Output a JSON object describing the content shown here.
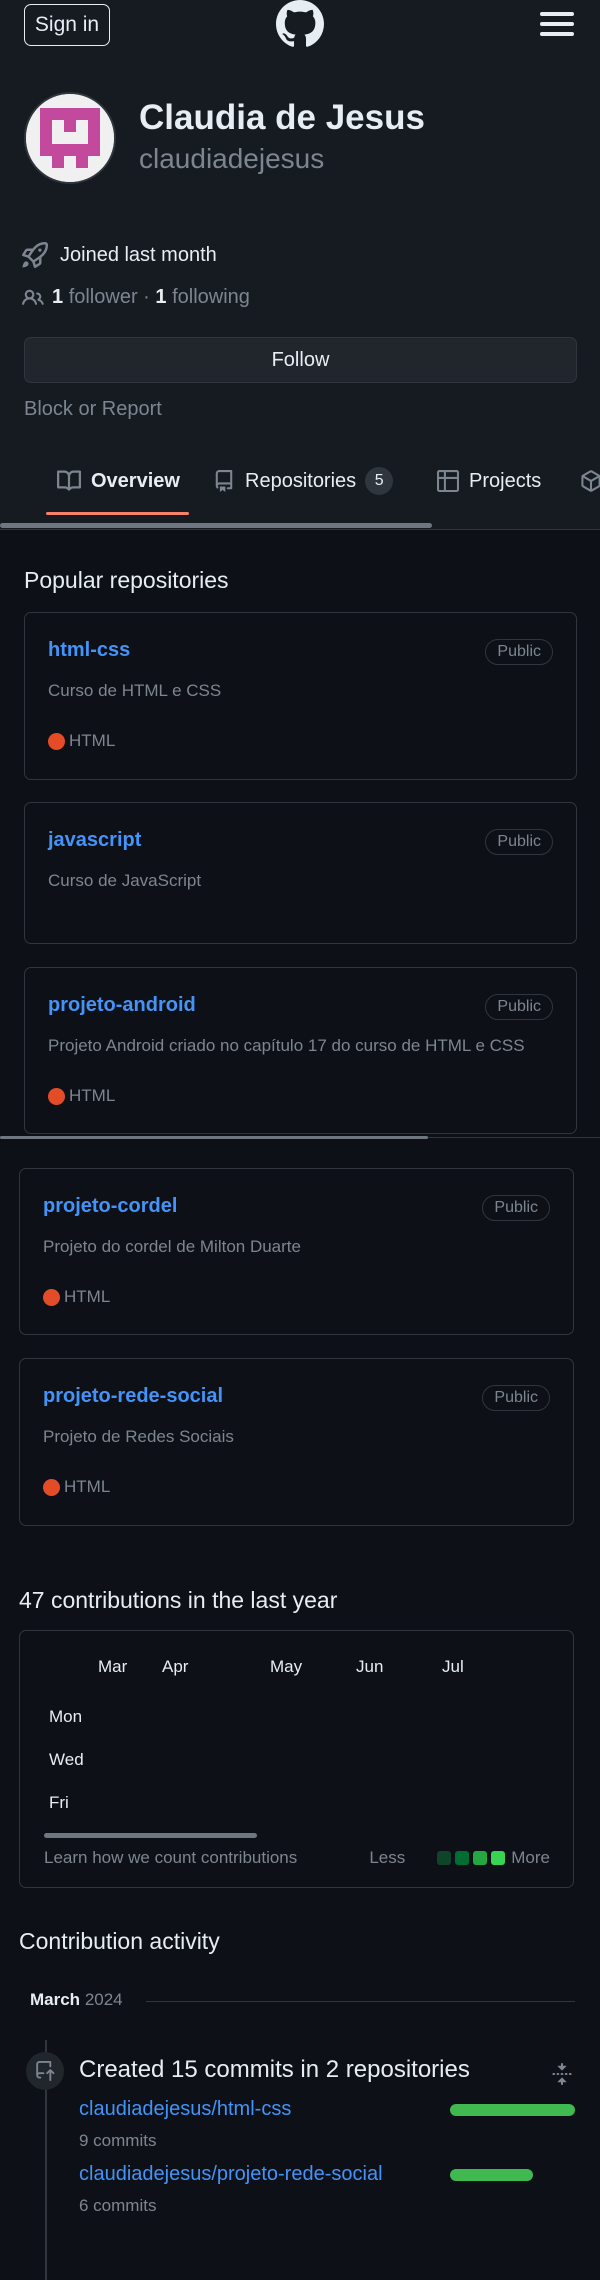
{
  "header": {
    "signin_label": "Sign in"
  },
  "profile": {
    "full_name": "Claudia de Jesus",
    "username": "claudiadejesus",
    "joined": "Joined last month",
    "followers_count": "1",
    "followers_label": "follower",
    "separator": "·",
    "following_count": "1",
    "following_label": "following",
    "follow_label": "Follow",
    "block_label": "Block or Report"
  },
  "tabs": [
    {
      "label": "Overview",
      "icon": "book-icon"
    },
    {
      "label": "Repositories",
      "icon": "repo-icon",
      "count": "5"
    },
    {
      "label": "Projects",
      "icon": "table-icon"
    }
  ],
  "popular": {
    "title": "Popular repositories",
    "repos": [
      {
        "name": "html-css",
        "visibility": "Public",
        "description": "Curso de HTML e CSS",
        "language": "HTML"
      },
      {
        "name": "javascript",
        "visibility": "Public",
        "description": "Curso de JavaScript",
        "language": ""
      },
      {
        "name": "projeto-android",
        "visibility": "Public",
        "description": "Projeto Android criado no capítulo 17 do curso de HTML e CSS",
        "language": "HTML"
      },
      {
        "name": "projeto-cordel",
        "visibility": "Public",
        "description": "Projeto do cordel de Milton Duarte",
        "language": "HTML"
      },
      {
        "name": "projeto-rede-social",
        "visibility": "Public",
        "description": "Projeto de Redes Sociais",
        "language": "HTML"
      }
    ]
  },
  "contributions": {
    "title": "47 contributions in the last year",
    "months": [
      "Mar",
      "Apr",
      "May",
      "Jun",
      "Jul"
    ],
    "days": [
      "Mon",
      "Wed",
      "Fri"
    ],
    "learn_link": "Learn how we count contributions",
    "legend_less": "Less",
    "legend_more": "More"
  },
  "activity": {
    "title": "Contribution activity",
    "month": "March",
    "year": "2024",
    "event_title": "Created 15 commits in 2 repositories",
    "repos": [
      {
        "name": "claudiadejesus/html-css",
        "commits": "9 commits",
        "share": 0.6
      },
      {
        "name": "claudiadejesus/projeto-rede-social",
        "commits": "6 commits",
        "share": 0.4
      }
    ]
  },
  "colors": {
    "accent_link": "#4493f8",
    "html_language": "#e34c26",
    "tab_underline": "#f78166",
    "contribution_green": "#3fb950"
  }
}
